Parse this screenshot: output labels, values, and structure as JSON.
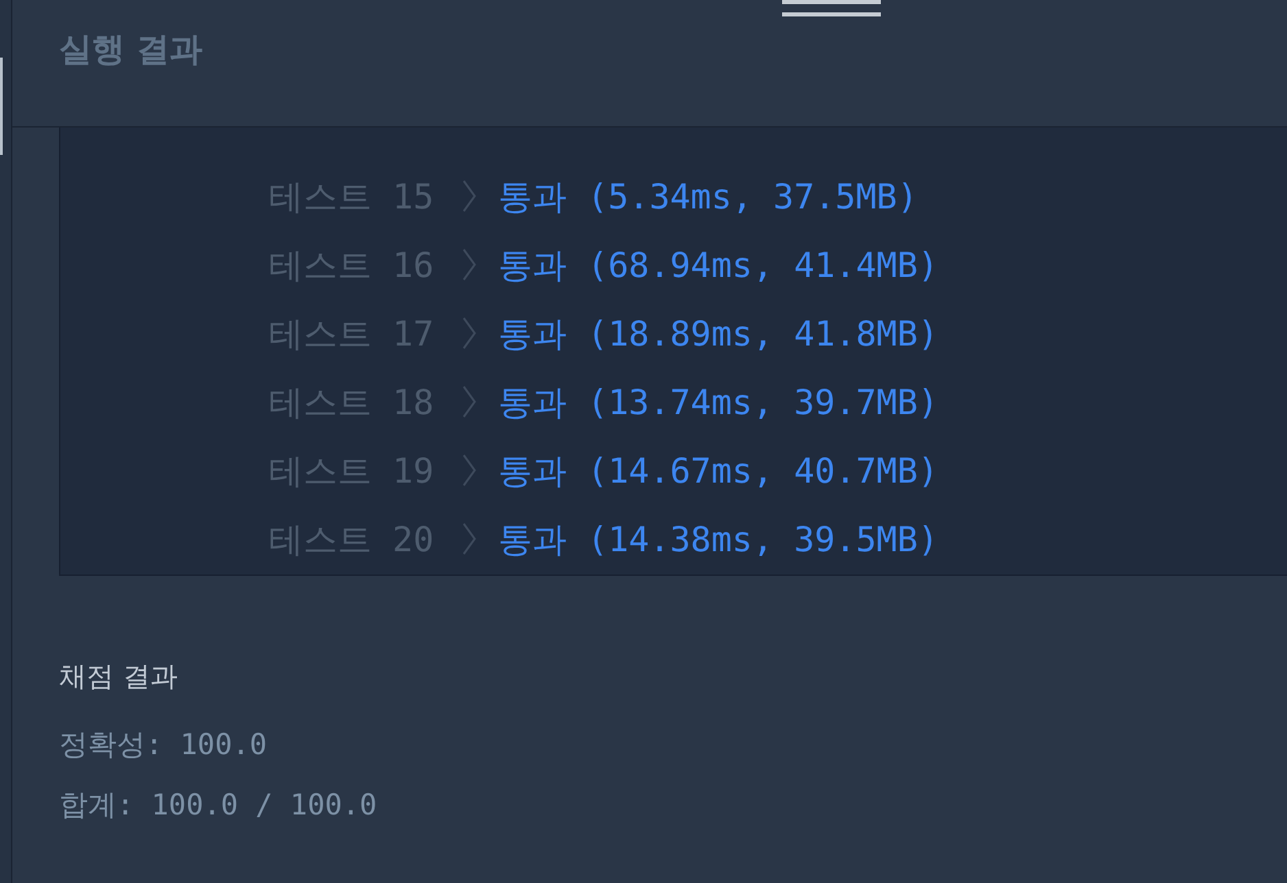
{
  "header": {
    "title": "실행 결과"
  },
  "tests": [
    {
      "label": "테스트 15",
      "result": "통과 (5.34ms, 37.5MB)"
    },
    {
      "label": "테스트 16",
      "result": "통과 (68.94ms, 41.4MB)"
    },
    {
      "label": "테스트 17",
      "result": "통과 (18.89ms, 41.8MB)"
    },
    {
      "label": "테스트 18",
      "result": "통과 (13.74ms, 39.7MB)"
    },
    {
      "label": "테스트 19",
      "result": "통과 (14.67ms, 40.7MB)"
    },
    {
      "label": "테스트 20",
      "result": "통과 (14.38ms, 39.5MB)"
    }
  ],
  "grading": {
    "title": "채점 결과",
    "lines": [
      "정확성: 100.0",
      "합계: 100.0 / 100.0"
    ]
  }
}
